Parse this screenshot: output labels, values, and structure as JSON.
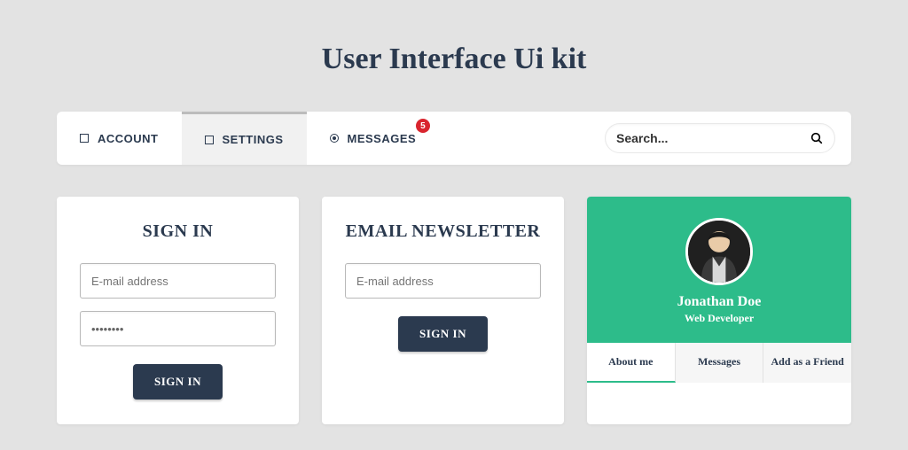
{
  "title": "User Interface Ui kit",
  "tabs": {
    "account": "ACCOUNT",
    "settings": "SETTINGS",
    "messages": "MESSAGES",
    "messages_badge": "5"
  },
  "search": {
    "placeholder": "Search..."
  },
  "signin": {
    "title": "SIGN IN",
    "email_placeholder": "E-mail address",
    "password_value": "••••••••",
    "button": "SIGN IN"
  },
  "newsletter": {
    "title": "EMAIL NEWSLETTER",
    "email_placeholder": "E-mail address",
    "button": "SIGN IN"
  },
  "profile": {
    "name": "Jonathan Doe",
    "role": "Web Developer",
    "tabs": {
      "about": "About me",
      "messages": "Messages",
      "add_friend": "Add as a Friend"
    }
  },
  "colors": {
    "accent": "#2dbc8a",
    "dark": "#2b3a4f",
    "badge": "#d9252e"
  }
}
